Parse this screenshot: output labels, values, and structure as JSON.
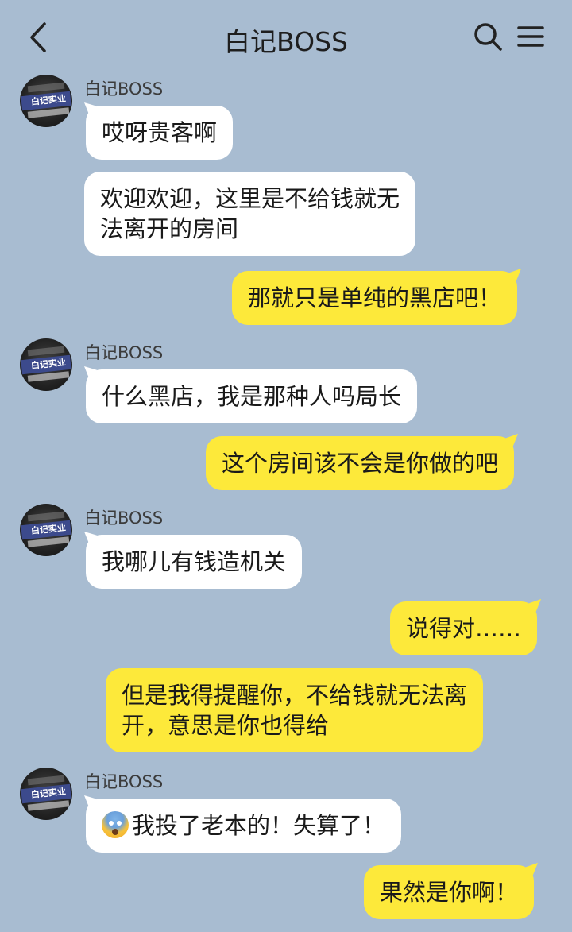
{
  "header": {
    "title": "白记BOSS",
    "back_icon": "chevron-left-icon",
    "search_icon": "search-icon",
    "menu_icon": "menu-icon"
  },
  "avatar": {
    "text": "白记实业"
  },
  "messages": [
    {
      "side": "left",
      "sender": "白记BOSS",
      "text": "哎呀贵客啊"
    },
    {
      "side": "left",
      "text": "欢迎欢迎，这里是不给钱就无\n法离开的房间"
    },
    {
      "side": "right",
      "text": "那就只是单纯的黑店吧！"
    },
    {
      "side": "left",
      "sender": "白记BOSS",
      "text": "什么黑店，我是那种人吗局长"
    },
    {
      "side": "right",
      "text": "这个房间该不会是你做的吧"
    },
    {
      "side": "left",
      "sender": "白记BOSS",
      "text": "我哪儿有钱造机关"
    },
    {
      "side": "right",
      "text": "说得对……"
    },
    {
      "side": "right",
      "text": "但是我得提醒你，不给钱就无法离\n开，意思是你也得给"
    },
    {
      "side": "left",
      "sender": "白记BOSS",
      "emoji": "screaming-face-icon",
      "text": "我投了老本的！失算了！"
    },
    {
      "side": "right",
      "text": "果然是你啊！"
    }
  ],
  "colors": {
    "background": "#a8bcd1",
    "left_bubble": "#ffffff",
    "right_bubble": "#fde93a"
  }
}
